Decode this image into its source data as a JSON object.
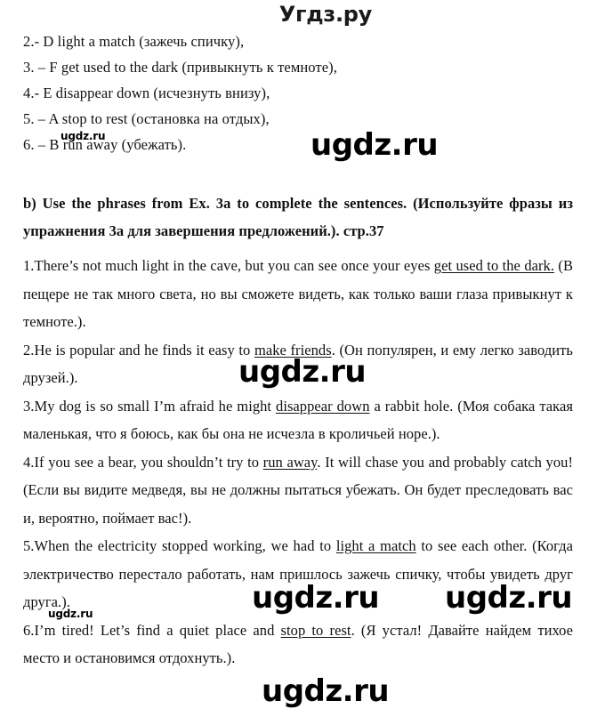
{
  "site": {
    "header_brand": "Угдз.ру",
    "watermark_text": "ugdz.ru"
  },
  "answer_key": {
    "items": [
      "2.- D light a match  (зажечь спичку),",
      "3. – F get used to the dark (привыкнуть к темноте),",
      "4.- E disappear down (исчезнуть внизу),",
      "5. – A stop to rest (остановка на отдых),",
      "6. – B run away (убежать)."
    ]
  },
  "task": {
    "heading": "b) Use the phrases from Ex. 3a to complete the sentences. (Используйте фразы из упражнения 3a для завершения предложений.). стр.37"
  },
  "sentences": [
    {
      "number": "1.",
      "before": "There’s not much light in the cave, but you can see once your eyes ",
      "answer": "get used to the dark.",
      "after": " (В пещере не так много света, но вы сможете видеть, как только ваши глаза привыкнут к темноте.)."
    },
    {
      "number": "2.",
      "before": "He is popular and he finds it easy to ",
      "answer": "make friends",
      "after": ". (Он популярен, и ему легко заводить друзей.)."
    },
    {
      "number": "3.",
      "before": "My dog is so small I’m afraid he might ",
      "answer": "disappear down",
      "after": "  a rabbit hole. (Моя собака такая маленькая, что я боюсь, как бы она не исчезла в кроличьей норе.)."
    },
    {
      "number": "4.",
      "before": "If you see a bear, you shouldn’t try to ",
      "answer": "run away",
      "after": ". It will chase you and probably catch you! (Если вы видите медведя, вы не должны пытаться убежать. Он будет преследовать вас и, вероятно, поймает вас!)."
    },
    {
      "number": "5.",
      "before": "When the electricity stopped working, we had to ",
      "answer": "light a match",
      "after": "  to see each other. (Когда электричество перестало работать, нам пришлось зажечь спичку, чтобы увидеть друг друга.)."
    },
    {
      "number": "6.",
      "before": "I’m tired! Let’s find a quiet place and ",
      "answer": "stop to rest",
      "after": ". (Я устал! Давайте найдем тихое место и остановимся отдохнуть.)."
    }
  ]
}
